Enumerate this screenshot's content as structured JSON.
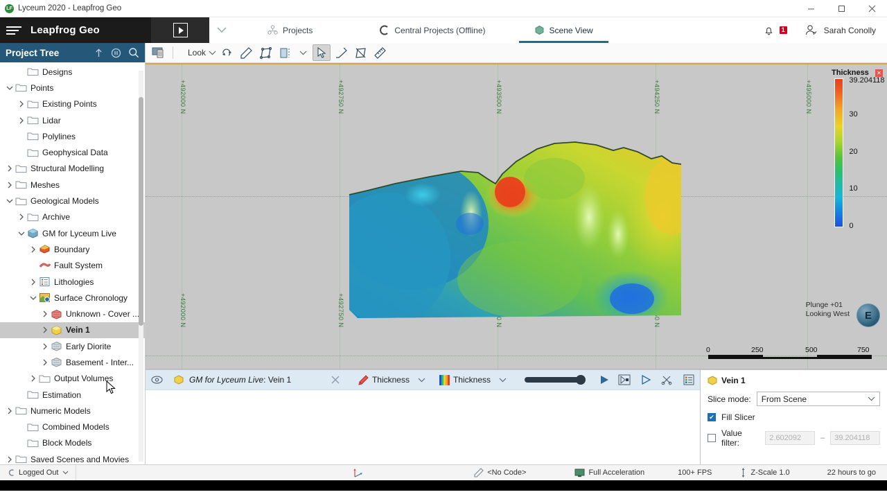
{
  "window": {
    "title": "Lyceum 2020 - Leapfrog Geo",
    "minimize": "—",
    "maximize": "❐",
    "close": "✕"
  },
  "header": {
    "brand": "Leapfrog Geo",
    "tabs": [
      {
        "label": "Projects",
        "icon": "projects-icon",
        "active": false
      },
      {
        "label": "Central Projects (Offline)",
        "icon": "central-icon",
        "active": false
      },
      {
        "label": "Scene View",
        "icon": "scene-icon",
        "active": true
      }
    ],
    "notification_count": "1",
    "user": "Sarah Conolly"
  },
  "sidebar": {
    "title": "Project Tree",
    "items": [
      {
        "label": "Designs",
        "indent": 1,
        "arrow": "",
        "icon": "folder"
      },
      {
        "label": "Points",
        "indent": 0,
        "arrow": "v",
        "icon": "folder"
      },
      {
        "label": "Existing Points",
        "indent": 1,
        "arrow": ">",
        "icon": "folder"
      },
      {
        "label": "Lidar",
        "indent": 1,
        "arrow": ">",
        "icon": "folder"
      },
      {
        "label": "Polylines",
        "indent": 1,
        "arrow": "",
        "icon": "folder"
      },
      {
        "label": "Geophysical Data",
        "indent": 1,
        "arrow": "",
        "icon": "folder"
      },
      {
        "label": "Structural Modelling",
        "indent": 0,
        "arrow": ">",
        "icon": "folder"
      },
      {
        "label": "Meshes",
        "indent": 0,
        "arrow": ">",
        "icon": "folder"
      },
      {
        "label": "Geological Models",
        "indent": 0,
        "arrow": "v",
        "icon": "folder"
      },
      {
        "label": "Archive",
        "indent": 1,
        "arrow": ">",
        "icon": "folder"
      },
      {
        "label": "GM for Lyceum Live",
        "indent": 1,
        "arrow": "v",
        "icon": "model"
      },
      {
        "label": "Boundary",
        "indent": 2,
        "arrow": ">",
        "icon": "boundary"
      },
      {
        "label": "Fault System",
        "indent": 2,
        "arrow": "",
        "icon": "fault"
      },
      {
        "label": "Lithologies",
        "indent": 2,
        "arrow": ">",
        "icon": "litho"
      },
      {
        "label": "Surface Chronology",
        "indent": 2,
        "arrow": "v",
        "icon": "chrono"
      },
      {
        "label": "Unknown - Cover ...",
        "indent": 3,
        "arrow": ">",
        "icon": "surf-red"
      },
      {
        "label": "Vein 1",
        "indent": 3,
        "arrow": ">",
        "icon": "surf-yellow",
        "selected": true
      },
      {
        "label": "Early Diorite",
        "indent": 3,
        "arrow": ">",
        "icon": "surf-grey"
      },
      {
        "label": "Basement - Inter...",
        "indent": 3,
        "arrow": ">",
        "icon": "surf-grey"
      },
      {
        "label": "Output Volumes",
        "indent": 2,
        "arrow": ">",
        "icon": "folder"
      },
      {
        "label": "Estimation",
        "indent": 1,
        "arrow": "",
        "icon": "folder"
      },
      {
        "label": "Numeric Models",
        "indent": 0,
        "arrow": ">",
        "icon": "folder"
      },
      {
        "label": "Combined Models",
        "indent": 1,
        "arrow": "",
        "icon": "folder"
      },
      {
        "label": "Block Models",
        "indent": 1,
        "arrow": "",
        "icon": "folder"
      },
      {
        "label": "Saved Scenes and Movies",
        "indent": 0,
        "arrow": ">",
        "icon": "folder"
      }
    ]
  },
  "scene_toolbar": {
    "look_label": "Look",
    "buttons": [
      "clean-scene-icon",
      "look-rotate-icon",
      "look-pencil-icon",
      "look-plane-icon",
      "slicer-icon",
      "select-arrow-icon",
      "draw-line-icon",
      "draw-plane-icon",
      "ruler-icon"
    ]
  },
  "scene": {
    "axis_labels": [
      "+492000 N",
      "+492750 N",
      "+493500 N",
      "+494250 N",
      "+495000 N"
    ],
    "legend": {
      "title": "Thickness",
      "max": "39.204118",
      "ticks": [
        "39.204118",
        "30",
        "20",
        "10",
        "0"
      ]
    },
    "scalebar": {
      "ticks": [
        "0",
        "250",
        "500",
        "750"
      ]
    },
    "compass": {
      "letter": "E",
      "line1": "Plunge +01",
      "line2": "Looking West"
    }
  },
  "shape_list": {
    "name_prefix": "GM for Lyceum Live",
    "name_suffix": "Vein 1",
    "color_by": "Thickness",
    "colormap": "Thickness",
    "icons": [
      "visibility-icon",
      "remove-icon",
      "colour-pencil-icon",
      "colourmap-icon",
      "opacity-slider",
      "play-icon",
      "flip-icon",
      "play-outline-icon",
      "scissors-icon",
      "list-icon"
    ]
  },
  "properties": {
    "title": "Vein 1",
    "slice_mode_label": "Slice mode:",
    "slice_mode_value": "From Scene",
    "fill_slicer_label": "Fill Slicer",
    "fill_slicer_checked": true,
    "value_filter_label": "Value filter:",
    "value_filter_checked": false,
    "value_filter_min": "2.602092",
    "value_filter_max": "39.204118"
  },
  "status": {
    "logged": "Logged Out",
    "code": "<No Code>",
    "acceleration": "Full Acceleration",
    "fps": "100+ FPS",
    "zscale": "Z-Scale 1.0",
    "trial": "22 hours to go"
  },
  "colors": {
    "accent": "#1f6b8e",
    "tree_header": "#245778",
    "alert": "#d0021b",
    "scene_bg": "#c8c8c8",
    "shape_row": "#ddeaf3"
  }
}
